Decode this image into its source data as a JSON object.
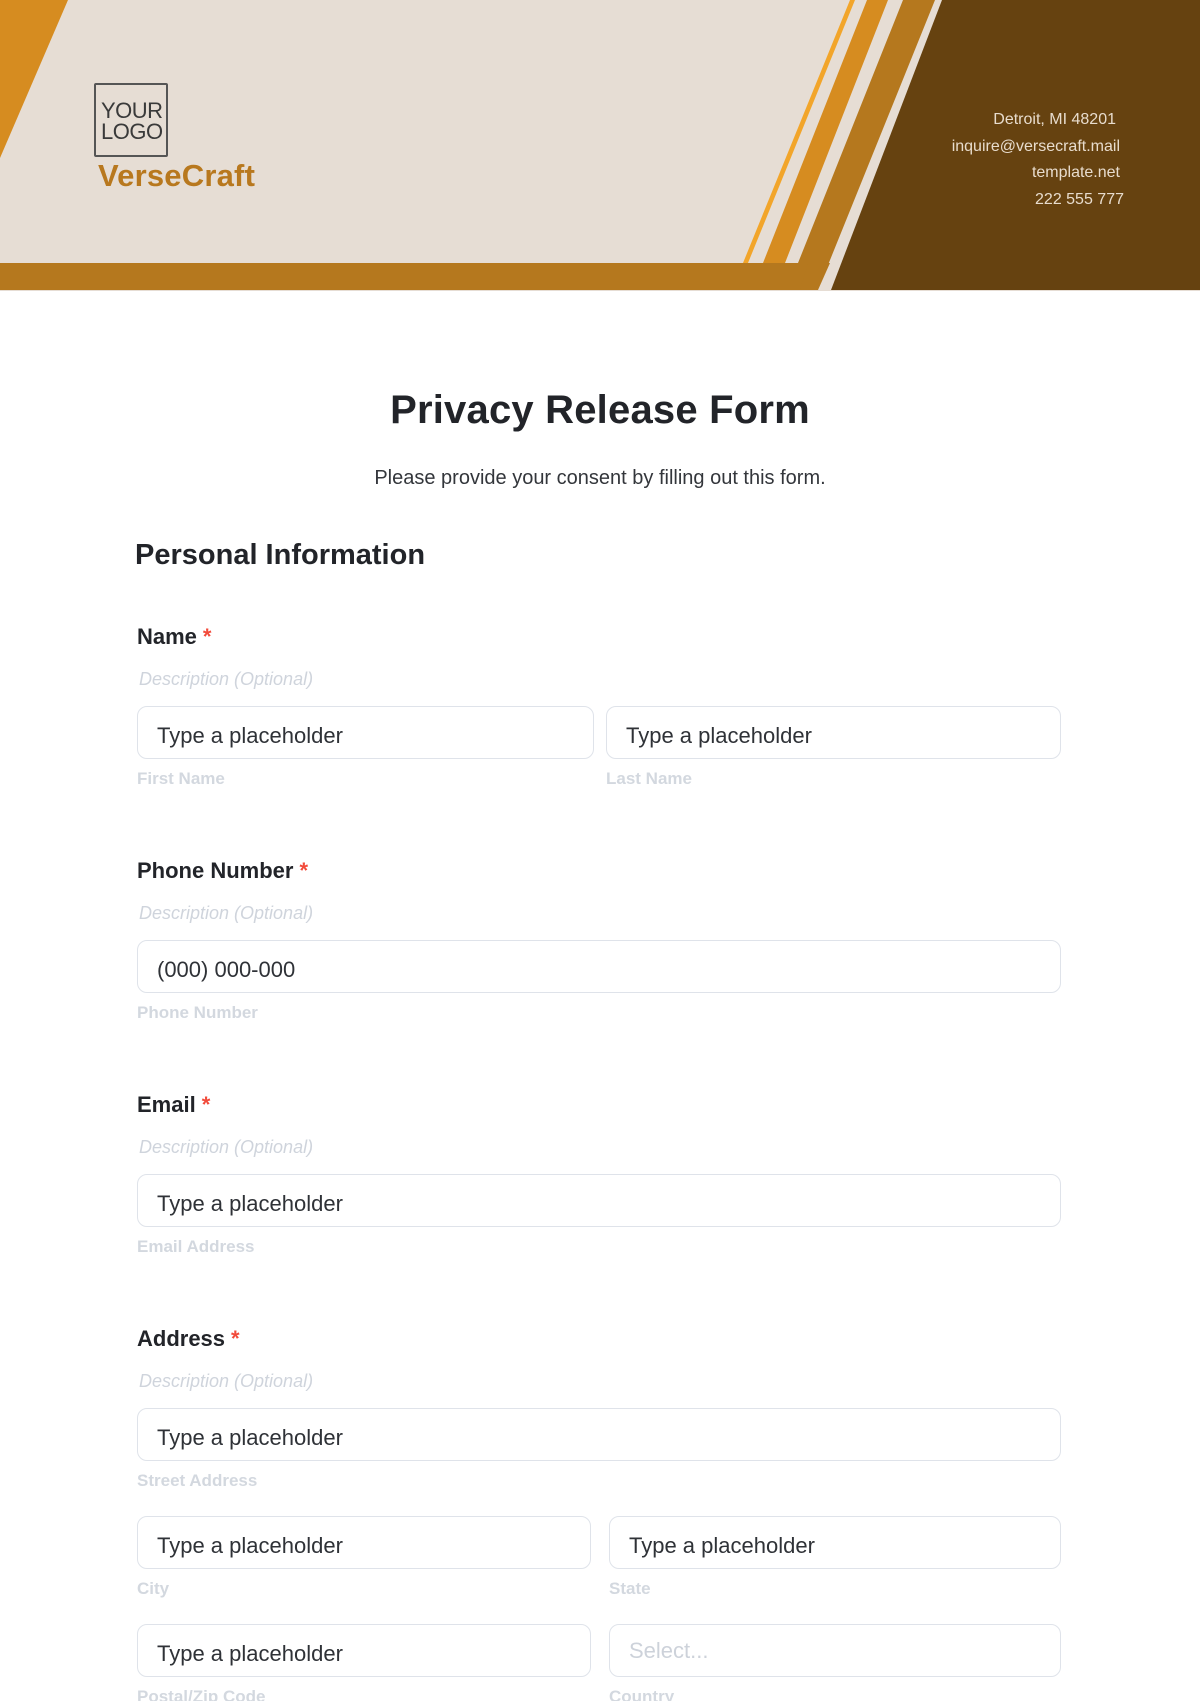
{
  "header": {
    "logo_text_line1": "YOUR",
    "logo_text_line2": "LOGO",
    "brand_name": "VerseCraft",
    "contact": {
      "address": "Detroit, MI 48201",
      "email": "inquire@versecraft.mail",
      "website": "template.net",
      "phone": "222 555 777"
    },
    "colors": {
      "background": "#e6ddd4",
      "orange": "#d68c20",
      "gold": "#b5781e",
      "dark_brown": "#664210",
      "thin_line": "#f2a52a"
    }
  },
  "form": {
    "title": "Privacy Release Form",
    "subtitle": "Please provide your consent by filling out this form.",
    "section_title": "Personal Information",
    "required_marker": "*",
    "fields": {
      "name": {
        "label": "Name",
        "description": "Description (Optional)",
        "first": {
          "value": "Type a placeholder",
          "sublabel": "First Name"
        },
        "last": {
          "value": "Type a placeholder",
          "sublabel": "Last Name"
        }
      },
      "phone": {
        "label": "Phone Number",
        "description": "Description (Optional)",
        "value": "(000) 000-000",
        "sublabel": "Phone Number"
      },
      "email": {
        "label": "Email",
        "description": "Description (Optional)",
        "value": "Type a placeholder",
        "sublabel": "Email Address"
      },
      "address": {
        "label": "Address",
        "description": "Description (Optional)",
        "street": {
          "value": "Type a placeholder",
          "sublabel": "Street Address"
        },
        "city": {
          "value": "Type a placeholder",
          "sublabel": "City"
        },
        "state": {
          "value": "Type a placeholder",
          "sublabel": "State"
        },
        "postal": {
          "value": "Type a placeholder",
          "sublabel": "Postal/Zip Code"
        },
        "country": {
          "placeholder": "Select...",
          "sublabel": "Country"
        }
      }
    }
  }
}
